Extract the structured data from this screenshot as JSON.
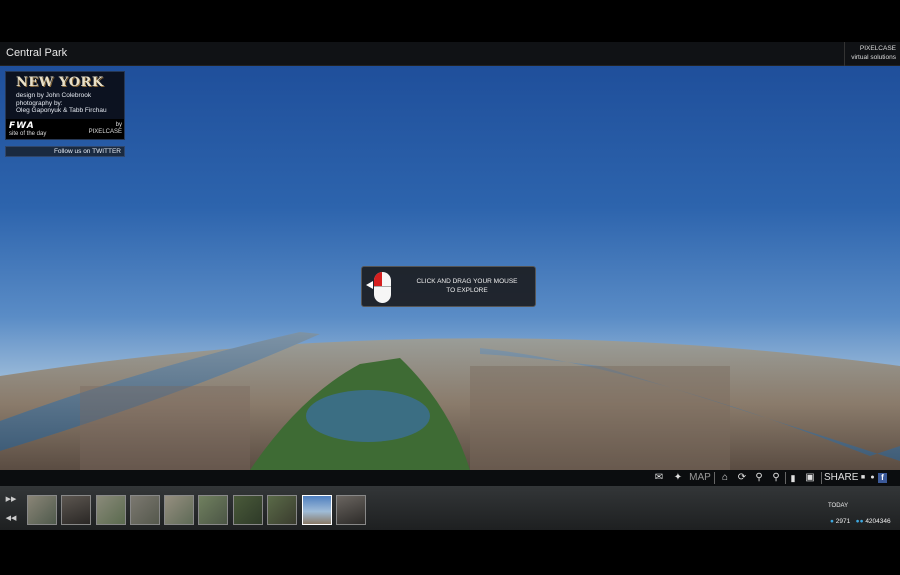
{
  "header": {
    "title": "Central Park",
    "brand_name": "PIXELCASE",
    "brand_tagline": "virtual solutions"
  },
  "info_panel": {
    "city": "NEW YORK",
    "design_credit": "design by John Colebrook",
    "photo_label": "photography by:",
    "photographers": "Oleg Gaponyuk & Tabb Firchau",
    "award_logo": "FWA",
    "award_text": "site of the day",
    "by_label": "by",
    "by_name": "PIXELCASE"
  },
  "twitter_link": "Follow us on TWITTER",
  "hint": {
    "line1": "CLICK AND DRAG YOUR MOUSE",
    "line2": "TO EXPLORE"
  },
  "toolbar": {
    "map_label": "MAP",
    "share_label": "SHARE",
    "icons": [
      "mail-icon",
      "pin-icon",
      "home-icon",
      "rotate-icon",
      "zoom-in-icon",
      "zoom-out-icon",
      "ipod-icon",
      "fullscreen-icon",
      "delicious-icon",
      "myspace-icon",
      "facebook-icon"
    ]
  },
  "thumbnails": {
    "count": 10,
    "active_index": 8
  },
  "footer": {
    "today_label": "TODAY",
    "today_count": "2971",
    "total_count": "4204346"
  },
  "colors": {
    "sky": "#2d64ad",
    "panel": "#0c1220",
    "hint_mouse_button": "#d51f1f",
    "stats_icon": "#3fa9e0"
  }
}
